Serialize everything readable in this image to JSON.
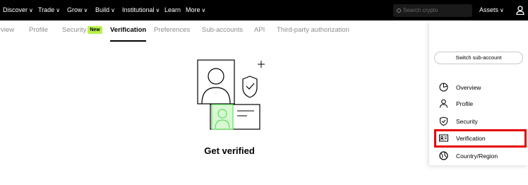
{
  "topnav": {
    "items": [
      {
        "label": "Discover",
        "has_chevron": true
      },
      {
        "label": "Trade",
        "has_chevron": true
      },
      {
        "label": "Grow",
        "has_chevron": true
      },
      {
        "label": "Build",
        "has_chevron": true
      },
      {
        "label": "Institutional",
        "has_chevron": true
      },
      {
        "label": "Learn",
        "has_chevron": false
      },
      {
        "label": "More",
        "has_chevron": true
      }
    ],
    "search_placeholder": "Search crypto",
    "assets_label": "Assets",
    "chevron": "∨"
  },
  "tabs": {
    "items": [
      "rview",
      "Profile",
      "Security",
      "Verification",
      "Preferences",
      "Sub-accounts",
      "API",
      "Third-party authorization"
    ],
    "security_badge": "New",
    "active": "Verification"
  },
  "main": {
    "title": "Get verified"
  },
  "panel": {
    "switch_label": "Switch sub-account",
    "items": [
      {
        "label": "Overview",
        "icon": "pie-chart-icon"
      },
      {
        "label": "Profile",
        "icon": "person-icon"
      },
      {
        "label": "Security",
        "icon": "shield-icon"
      },
      {
        "label": "Verification",
        "icon": "id-card-icon",
        "highlighted": true
      },
      {
        "label": "Country/Region",
        "icon": "globe-icon"
      }
    ]
  },
  "colors": {
    "topnav_bg": "#000000",
    "badge_green": "#b7f34a",
    "illustration_green": "#5ce05c",
    "highlight_red": "#e60000"
  }
}
